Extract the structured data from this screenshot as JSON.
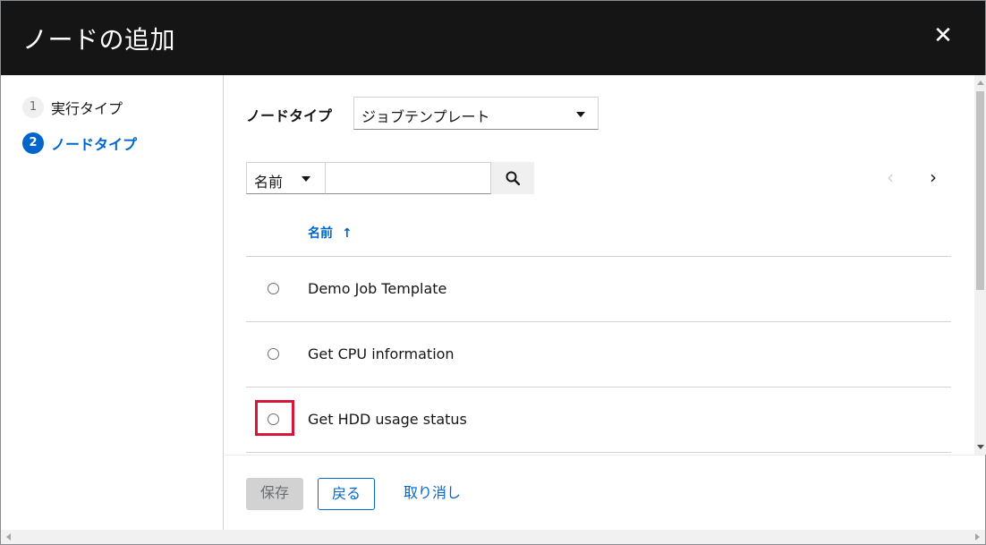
{
  "header": {
    "title": "ノードの追加",
    "close_icon": "close-icon"
  },
  "wizard_nav": {
    "steps": [
      {
        "number": "1",
        "label": "実行タイプ",
        "active": false
      },
      {
        "number": "2",
        "label": "ノードタイプ",
        "active": true
      }
    ]
  },
  "main": {
    "node_type_label": "ノードタイプ",
    "node_type_value": "ジョブテンプレート",
    "filter": {
      "field": "名前",
      "search_value": "",
      "search_icon": "search-icon"
    },
    "pagination": {
      "prev_icon": "chevron-left-icon",
      "next_icon": "chevron-right-icon"
    },
    "table": {
      "column": "名前",
      "sort_arrow": "↑",
      "rows": [
        {
          "name": "Demo Job Template",
          "selected": false
        },
        {
          "name": "Get CPU information",
          "selected": false
        },
        {
          "name": "Get HDD usage status",
          "selected": false,
          "highlighted": true
        }
      ]
    }
  },
  "footer": {
    "save": "保存",
    "back": "戻る",
    "cancel": "取り消し"
  },
  "colors": {
    "header_bg": "#151515",
    "accent": "#0066cc",
    "highlight": "#d8163a"
  }
}
